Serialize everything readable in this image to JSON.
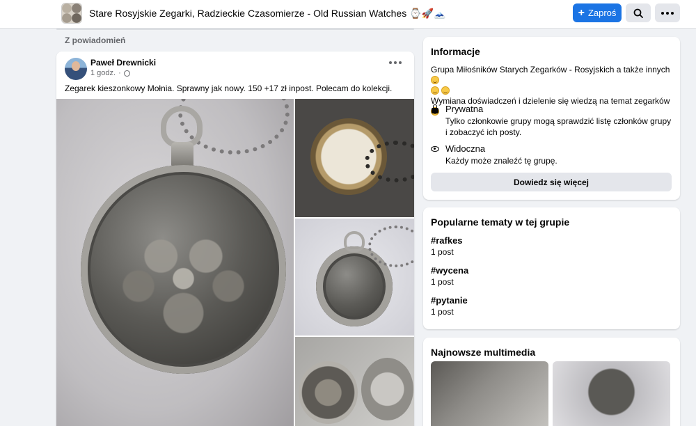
{
  "header": {
    "group_title": "Stare Rosyjskie Zegarki, Radzieckie Czasomierze - Old Russian Watches ⌚🚀🗻",
    "join_label": "Zaproś"
  },
  "feed": {
    "section_heading": "Z powiadomień",
    "post": {
      "author": "Paweł Drewnicki",
      "time": "1 godz.",
      "text": "Zegarek kieszonkowy Mołnia. Sprawny jak nowy. 150 +17 zł inpost. Polecam do kolekcji."
    }
  },
  "sidebar": {
    "info": {
      "title": "Informacje",
      "description_line1": "Grupa Miłośników Starych Zegarków - Rosyjskich a także innych",
      "description_line2": "Wymiana doświadczeń i dzielenie się wiedzą na temat zegarków",
      "privacy_label": "Prywatna",
      "privacy_desc": "Tylko członkowie grupy mogą sprawdzić listę członków grupy i zobaczyć ich posty.",
      "visibility_label": "Widoczna",
      "visibility_desc": "Każdy może znaleźć tę grupę.",
      "learn_more": "Dowiedz się więcej"
    },
    "topics": {
      "title": "Popularne tematy w tej grupie",
      "items": [
        {
          "tag": "#rafkes",
          "count": "1 post"
        },
        {
          "tag": "#wycena",
          "count": "1 post"
        },
        {
          "tag": "#pytanie",
          "count": "1 post"
        }
      ]
    },
    "media": {
      "title": "Najnowsze multimedia"
    }
  },
  "colors": {
    "accent": "#1b74e4",
    "background": "#f0f2f5"
  }
}
